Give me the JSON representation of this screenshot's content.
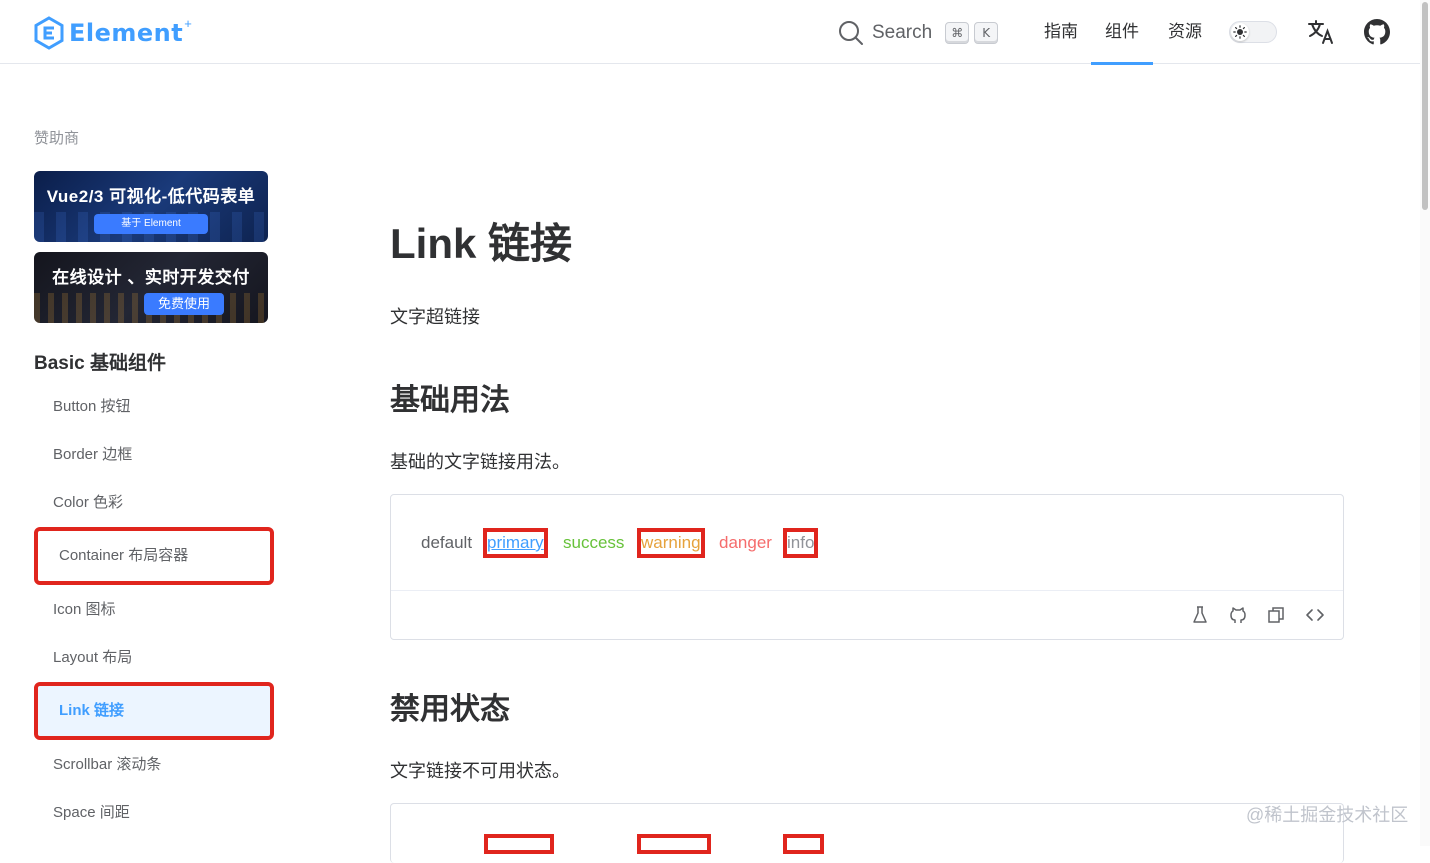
{
  "header": {
    "logo_text": "Element",
    "logo_plus": "+",
    "search_label": "Search",
    "search_keys": [
      "⌘",
      "K"
    ],
    "nav": [
      "指南",
      "组件",
      "资源"
    ],
    "active_nav": "组件"
  },
  "sidebar": {
    "sponsor_title": "赞助商",
    "banners": [
      {
        "title": "Vue2/3 可视化-低代码表单",
        "badge": "基于 Element"
      },
      {
        "title": "在线设计 、实时开发交付",
        "badge": "免费使用"
      }
    ],
    "group_title": "Basic 基础组件",
    "items": [
      {
        "label": "Button 按钮"
      },
      {
        "label": "Border 边框"
      },
      {
        "label": "Color 色彩"
      },
      {
        "label": "Container 布局容器"
      },
      {
        "label": "Icon 图标"
      },
      {
        "label": "Layout 布局"
      },
      {
        "label": "Link 链接"
      },
      {
        "label": "Scrollbar 滚动条"
      },
      {
        "label": "Space 间距"
      }
    ]
  },
  "main": {
    "title": "Link 链接",
    "description": "文字超链接",
    "basic": {
      "title": "基础用法",
      "description": "基础的文字链接用法。",
      "links": [
        {
          "label": "default",
          "color": "#606266"
        },
        {
          "label": "primary",
          "color": "#409eff"
        },
        {
          "label": "success",
          "color": "#67c23a"
        },
        {
          "label": "warning",
          "color": "#e6a23c"
        },
        {
          "label": "danger",
          "color": "#f56c6c"
        },
        {
          "label": "info",
          "color": "#909399"
        }
      ]
    },
    "disabled": {
      "title": "禁用状态",
      "description": "文字链接不可用状态。"
    }
  },
  "colors": {
    "brand": "#409eff",
    "highlight_box": "#e0251d"
  },
  "watermark": "@稀土掘金技术社区"
}
